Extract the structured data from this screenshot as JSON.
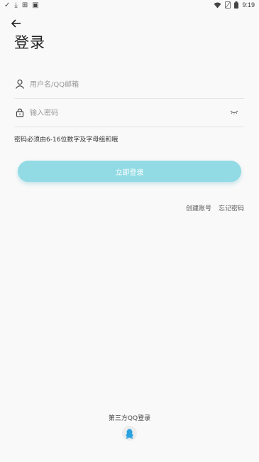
{
  "status_bar": {
    "time": "9:19",
    "icons": [
      "check-icon",
      "download-icon",
      "app-icon",
      "notification-icon",
      "wifi-icon",
      "sim-icon",
      "battery-icon"
    ]
  },
  "header": {
    "title": "登录"
  },
  "form": {
    "username_placeholder": "用户名/QQ邮箱",
    "username_value": "",
    "password_placeholder": "输入密码",
    "password_value": "",
    "hint": "密码必须由6-16位数字及字母组和哦",
    "login_label": "立即登录"
  },
  "links": {
    "create_account": "创建账号",
    "forgot_password": "忘记密码"
  },
  "third_party": {
    "label": "第三方QQ登录"
  },
  "colors": {
    "accent": "#92dbe4",
    "qq_icon": "#2aa2e0",
    "background": "#f9f9f9"
  }
}
